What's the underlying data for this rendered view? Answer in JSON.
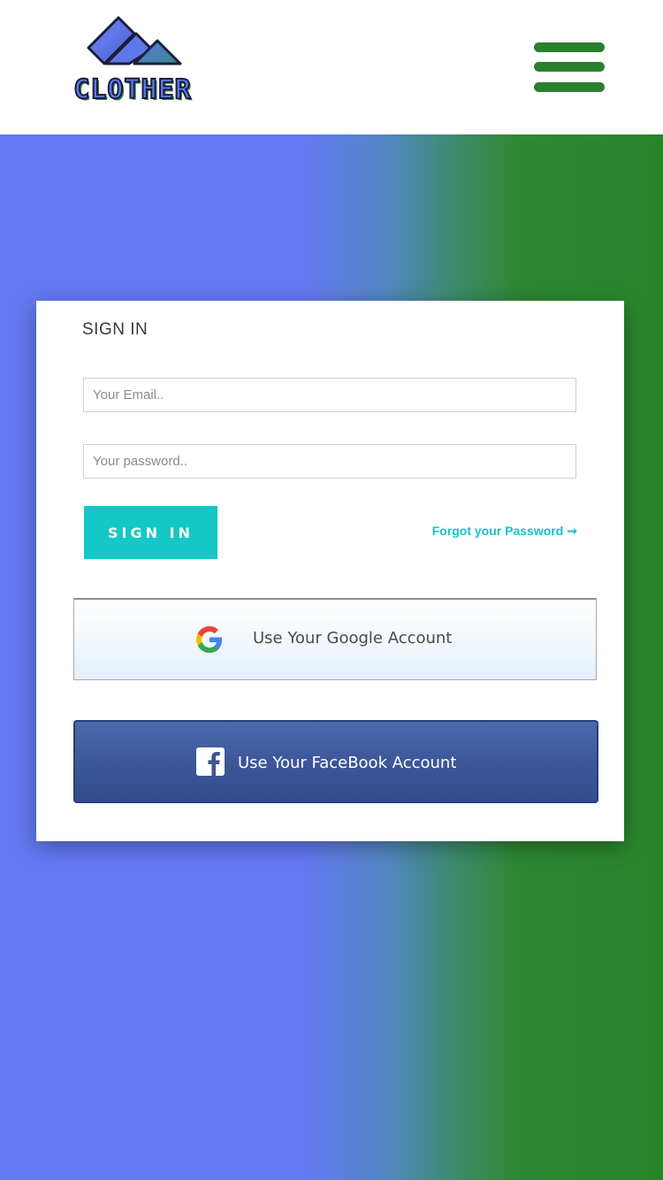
{
  "header": {
    "logo_text": "CLOTHER",
    "menu_icon": "hamburger-menu-icon"
  },
  "colors": {
    "accent_green": "#28812c",
    "gradient_start": "#6479f3",
    "gradient_end": "#27862a",
    "signin_button": "#13c8c7",
    "forgot_link": "#17c1cc",
    "facebook_blue": "#3c5697"
  },
  "signin": {
    "title": "SIGN IN",
    "email_placeholder": "Your Email..",
    "email_value": "",
    "password_placeholder": "Your password..",
    "password_value": "",
    "button_label": "SIGN IN",
    "forgot_label": "Forgot your Password",
    "forgot_icon": "arrow-right-icon"
  },
  "social": {
    "google_label": "Use Your Google Account",
    "google_icon": "google-icon",
    "facebook_label": "Use Your FaceBook Account",
    "facebook_icon": "facebook-icon"
  }
}
